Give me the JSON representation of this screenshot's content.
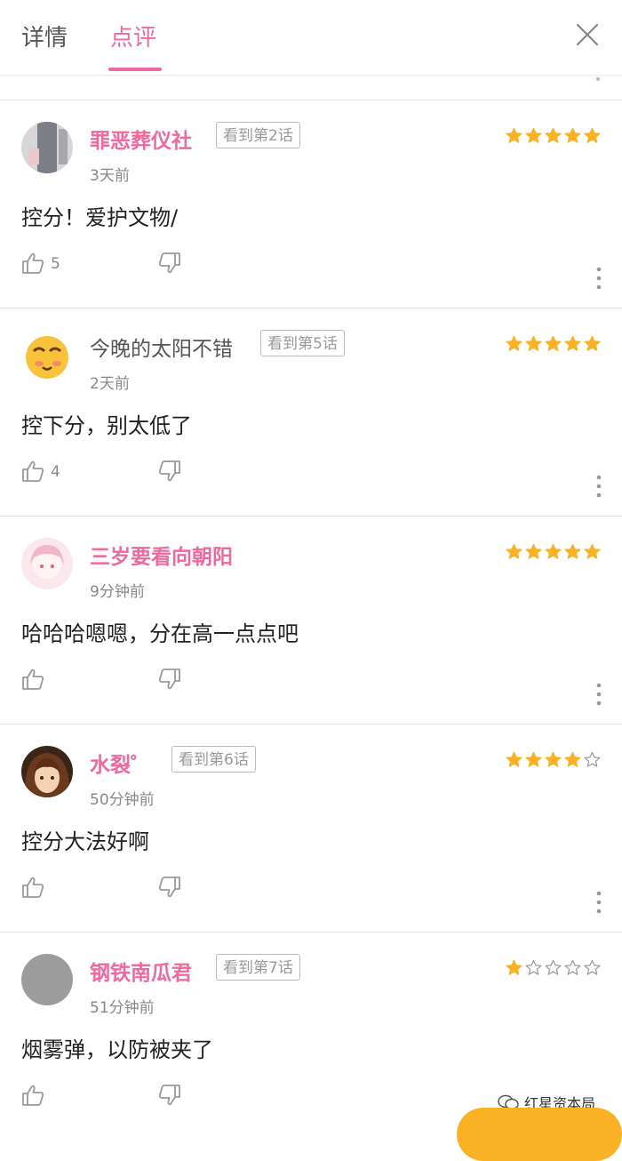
{
  "tabs": [
    {
      "label": "详情",
      "active": false
    },
    {
      "label": "点评",
      "active": true
    }
  ],
  "accent_color": "#f0699e",
  "star_color": "#fbb124",
  "comments": [
    {
      "username": "罪恶葬仪社",
      "highlighted": true,
      "seen": "看到第2话",
      "time": "3天前",
      "rating": 5,
      "text": "控分！爱护文物/",
      "likes": "5",
      "avatar": "sketch-avatar"
    },
    {
      "username": "今晚的太阳不错",
      "highlighted": false,
      "seen": "看到第5话",
      "time": "2天前",
      "rating": 5,
      "text": "控下分，别太低了",
      "likes": "4",
      "avatar": "emoji-face-avatar"
    },
    {
      "username": "三岁要看向朝阳",
      "highlighted": true,
      "seen": "",
      "time": "9分钟前",
      "rating": 5,
      "text": "哈哈哈嗯嗯，分在高一点点吧",
      "likes": "",
      "avatar": "anime-girl-avatar"
    },
    {
      "username": "水裂゜",
      "highlighted": true,
      "seen": "看到第6话",
      "time": "50分钟前",
      "rating": 4,
      "text": "控分大法好啊",
      "likes": "",
      "avatar": "anime-boy-avatar"
    },
    {
      "username": "钢铁南瓜君",
      "highlighted": true,
      "seen": "看到第7话",
      "time": "51分钟前",
      "rating": 1,
      "text": "烟雾弹，以防被夹了",
      "likes": "",
      "avatar": "gray-default-avatar"
    }
  ],
  "watermark": "红星资本局"
}
